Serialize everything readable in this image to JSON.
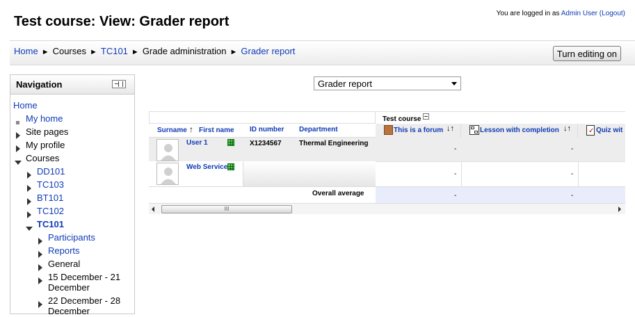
{
  "page": {
    "title": "Test course: View: Grader report"
  },
  "login": {
    "prefix": "You are logged in as",
    "user": "Admin User",
    "logout": "(Logout)"
  },
  "breadcrumb": {
    "items": [
      "Home",
      "Courses",
      "TC101",
      "Grade administration",
      "Grader report"
    ],
    "separator": "►"
  },
  "toolbar": {
    "edit_label": "Turn editing on"
  },
  "navigation": {
    "title": "Navigation",
    "items": [
      {
        "label": "Home"
      },
      {
        "label": "My home"
      },
      {
        "label": "Site pages"
      },
      {
        "label": "My profile"
      },
      {
        "label": "Courses"
      },
      {
        "label": "DD101"
      },
      {
        "label": "TC103"
      },
      {
        "label": "BT101"
      },
      {
        "label": "TC102"
      },
      {
        "label": "TC101"
      },
      {
        "label": "Participants"
      },
      {
        "label": "Reports"
      },
      {
        "label": "General"
      },
      {
        "label": "15 December - 21",
        "label2": "December"
      },
      {
        "label": "22 December - 28",
        "label2": "December"
      }
    ]
  },
  "report_selector": {
    "value": "Grader report"
  },
  "grader": {
    "course_label": "Test course",
    "headers": {
      "surname": "Surname",
      "first_name": "First name",
      "id_number": "ID number",
      "department": "Department"
    },
    "items": [
      {
        "name": "This is a forum"
      },
      {
        "name": "Lesson with completion"
      },
      {
        "name": "Quiz wit"
      }
    ],
    "rows": [
      {
        "name": "User 1",
        "id_number": "X1234567",
        "department": "Thermal Engineering",
        "grades": [
          "-",
          "-",
          ""
        ]
      },
      {
        "name": "Web Service",
        "id_number": "",
        "department": "",
        "grades": [
          "-",
          "-",
          ""
        ]
      }
    ],
    "average": {
      "label": "Overall average",
      "grades": [
        "-",
        "-",
        ""
      ]
    },
    "scrollbar_grip": "III"
  },
  "colors": {
    "link": "#0f3bb5",
    "accent_row": "#e8ecfb"
  }
}
